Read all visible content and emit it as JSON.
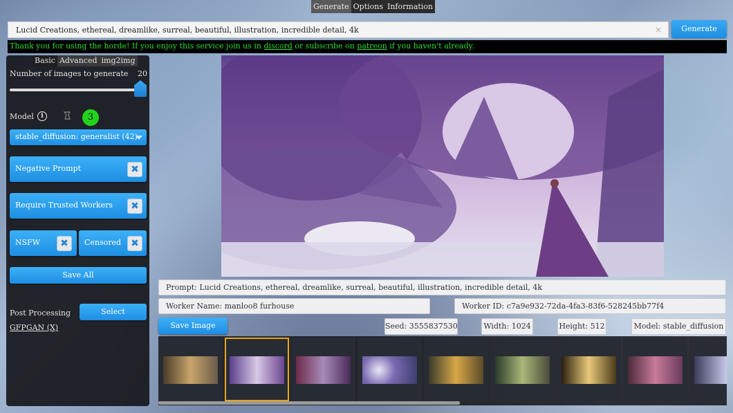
{
  "top_tabs": [
    "Generate",
    "Options",
    "Information"
  ],
  "prompt": {
    "value": "Lucid Creations, ethereal, dreamlike, surreal, beautiful, illustration, incredible detail, 4k",
    "clear_icon": "×"
  },
  "generate_label": "Generate",
  "notice": {
    "part1": "Thank you for using the horde! If you enjoy this service join us in ",
    "discord": "discord",
    "part2": " or subscribe on ",
    "patreon": "patreon",
    "part3": " if you haven't already."
  },
  "sub_tabs": [
    "Basic",
    "Advanced",
    "img2img"
  ],
  "num_images": {
    "label": "Number of images to generate",
    "value": "20"
  },
  "model": {
    "label": "Model",
    "info_icon": "i",
    "badge": "3",
    "selected": "stable_diffusion: generalist (42)"
  },
  "negative_prompt": "Negative Prompt",
  "require_trusted": "Require Trusted Workers",
  "nsfw": "NSFW",
  "censored": "Censored",
  "save_all": "Save All",
  "post_processing": {
    "label": "Post Processing",
    "select": "Select",
    "gfpgan": "GFPGAN",
    "gfpgan_x": "(X)"
  },
  "x_glyph": "✖",
  "details": {
    "prompt": "Prompt: Lucid Creations, ethereal, dreamlike, surreal, beautiful, illustration, incredible detail, 4k",
    "worker_name": "Worker Name: manloo8 furhouse",
    "worker_id": "Worker ID: c7a9e932-72da-4fa3-83f6-528245bb77f4",
    "save_image": "Save Image",
    "seed": "Seed: 3555837530",
    "width": "Width: 1024",
    "height": "Height: 512",
    "model": "Model: stable_diffusion"
  },
  "colors": {
    "accent": "#1c8fe0",
    "notice_text": "#2ede2e",
    "badge": "#22d31c",
    "selected_outline": "#e8a61a"
  }
}
